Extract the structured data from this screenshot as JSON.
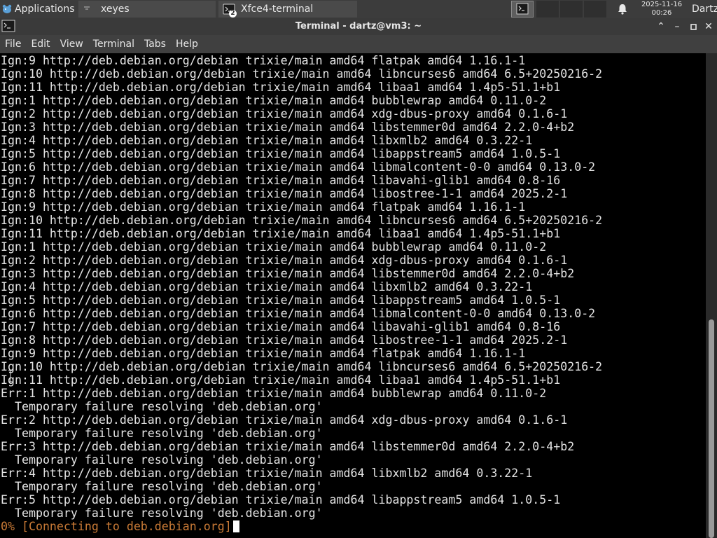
{
  "panel": {
    "applications_label": "Applications",
    "tasks": [
      {
        "label": "xeyes"
      },
      {
        "label": "Xfce4-terminal",
        "badge": "2"
      }
    ],
    "clock_date": "2025-11-16",
    "clock_time": "00:26",
    "user": "Dartz"
  },
  "window": {
    "title": "Terminal - dartz@vm3: ~"
  },
  "menu": {
    "items": [
      "File",
      "Edit",
      "View",
      "Terminal",
      "Tabs",
      "Help"
    ]
  },
  "terminal": {
    "lines": [
      "Ign:9 http://deb.debian.org/debian trixie/main amd64 flatpak amd64 1.16.1-1",
      "Ign:10 http://deb.debian.org/debian trixie/main amd64 libncurses6 amd64 6.5+20250216-2",
      "Ign:11 http://deb.debian.org/debian trixie/main amd64 libaa1 amd64 1.4p5-51.1+b1",
      "Ign:1 http://deb.debian.org/debian trixie/main amd64 bubblewrap amd64 0.11.0-2",
      "Ign:2 http://deb.debian.org/debian trixie/main amd64 xdg-dbus-proxy amd64 0.1.6-1",
      "Ign:3 http://deb.debian.org/debian trixie/main amd64 libstemmer0d amd64 2.2.0-4+b2",
      "Ign:4 http://deb.debian.org/debian trixie/main amd64 libxmlb2 amd64 0.3.22-1",
      "Ign:5 http://deb.debian.org/debian trixie/main amd64 libappstream5 amd64 1.0.5-1",
      "Ign:6 http://deb.debian.org/debian trixie/main amd64 libmalcontent-0-0 amd64 0.13.0-2",
      "Ign:7 http://deb.debian.org/debian trixie/main amd64 libavahi-glib1 amd64 0.8-16",
      "Ign:8 http://deb.debian.org/debian trixie/main amd64 libostree-1-1 amd64 2025.2-1",
      "Ign:9 http://deb.debian.org/debian trixie/main amd64 flatpak amd64 1.16.1-1",
      "Ign:10 http://deb.debian.org/debian trixie/main amd64 libncurses6 amd64 6.5+20250216-2",
      "Ign:11 http://deb.debian.org/debian trixie/main amd64 libaa1 amd64 1.4p5-51.1+b1",
      "Ign:1 http://deb.debian.org/debian trixie/main amd64 bubblewrap amd64 0.11.0-2",
      "Ign:2 http://deb.debian.org/debian trixie/main amd64 xdg-dbus-proxy amd64 0.1.6-1",
      "Ign:3 http://deb.debian.org/debian trixie/main amd64 libstemmer0d amd64 2.2.0-4+b2",
      "Ign:4 http://deb.debian.org/debian trixie/main amd64 libxmlb2 amd64 0.3.22-1",
      "Ign:5 http://deb.debian.org/debian trixie/main amd64 libappstream5 amd64 1.0.5-1",
      "Ign:6 http://deb.debian.org/debian trixie/main amd64 libmalcontent-0-0 amd64 0.13.0-2",
      "Ign:7 http://deb.debian.org/debian trixie/main amd64 libavahi-glib1 amd64 0.8-16",
      "Ign:8 http://deb.debian.org/debian trixie/main amd64 libostree-1-1 amd64 2025.2-1",
      "Ign:9 http://deb.debian.org/debian trixie/main amd64 flatpak amd64 1.16.1-1",
      "Ign:10 http://deb.debian.org/debian trixie/main amd64 libncurses6 amd64 6.5+20250216-2",
      "Ign:11 http://deb.debian.org/debian trixie/main amd64 libaa1 amd64 1.4p5-51.1+b1",
      "Err:1 http://deb.debian.org/debian trixie/main amd64 bubblewrap amd64 0.11.0-2",
      "  Temporary failure resolving 'deb.debian.org'",
      "Err:2 http://deb.debian.org/debian trixie/main amd64 xdg-dbus-proxy amd64 0.1.6-1",
      "  Temporary failure resolving 'deb.debian.org'",
      "Err:3 http://deb.debian.org/debian trixie/main amd64 libstemmer0d amd64 2.2.0-4+b2",
      "  Temporary failure resolving 'deb.debian.org'",
      "Err:4 http://deb.debian.org/debian trixie/main amd64 libxmlb2 amd64 0.3.22-1",
      "  Temporary failure resolving 'deb.debian.org'",
      "Err:5 http://deb.debian.org/debian trixie/main amd64 libappstream5 amd64 1.0.5-1",
      "  Temporary failure resolving 'deb.debian.org'"
    ],
    "progress_line": "0% [Connecting to deb.debian.org]"
  },
  "colors": {
    "progress_text": "#c97a36",
    "terminal_bg": "#000000",
    "terminal_fg": "#e5e5e5"
  },
  "icons": {
    "applications": "xfce-mouse-icon",
    "bell": "notification-bell-icon",
    "terminal": "terminal-icon"
  }
}
